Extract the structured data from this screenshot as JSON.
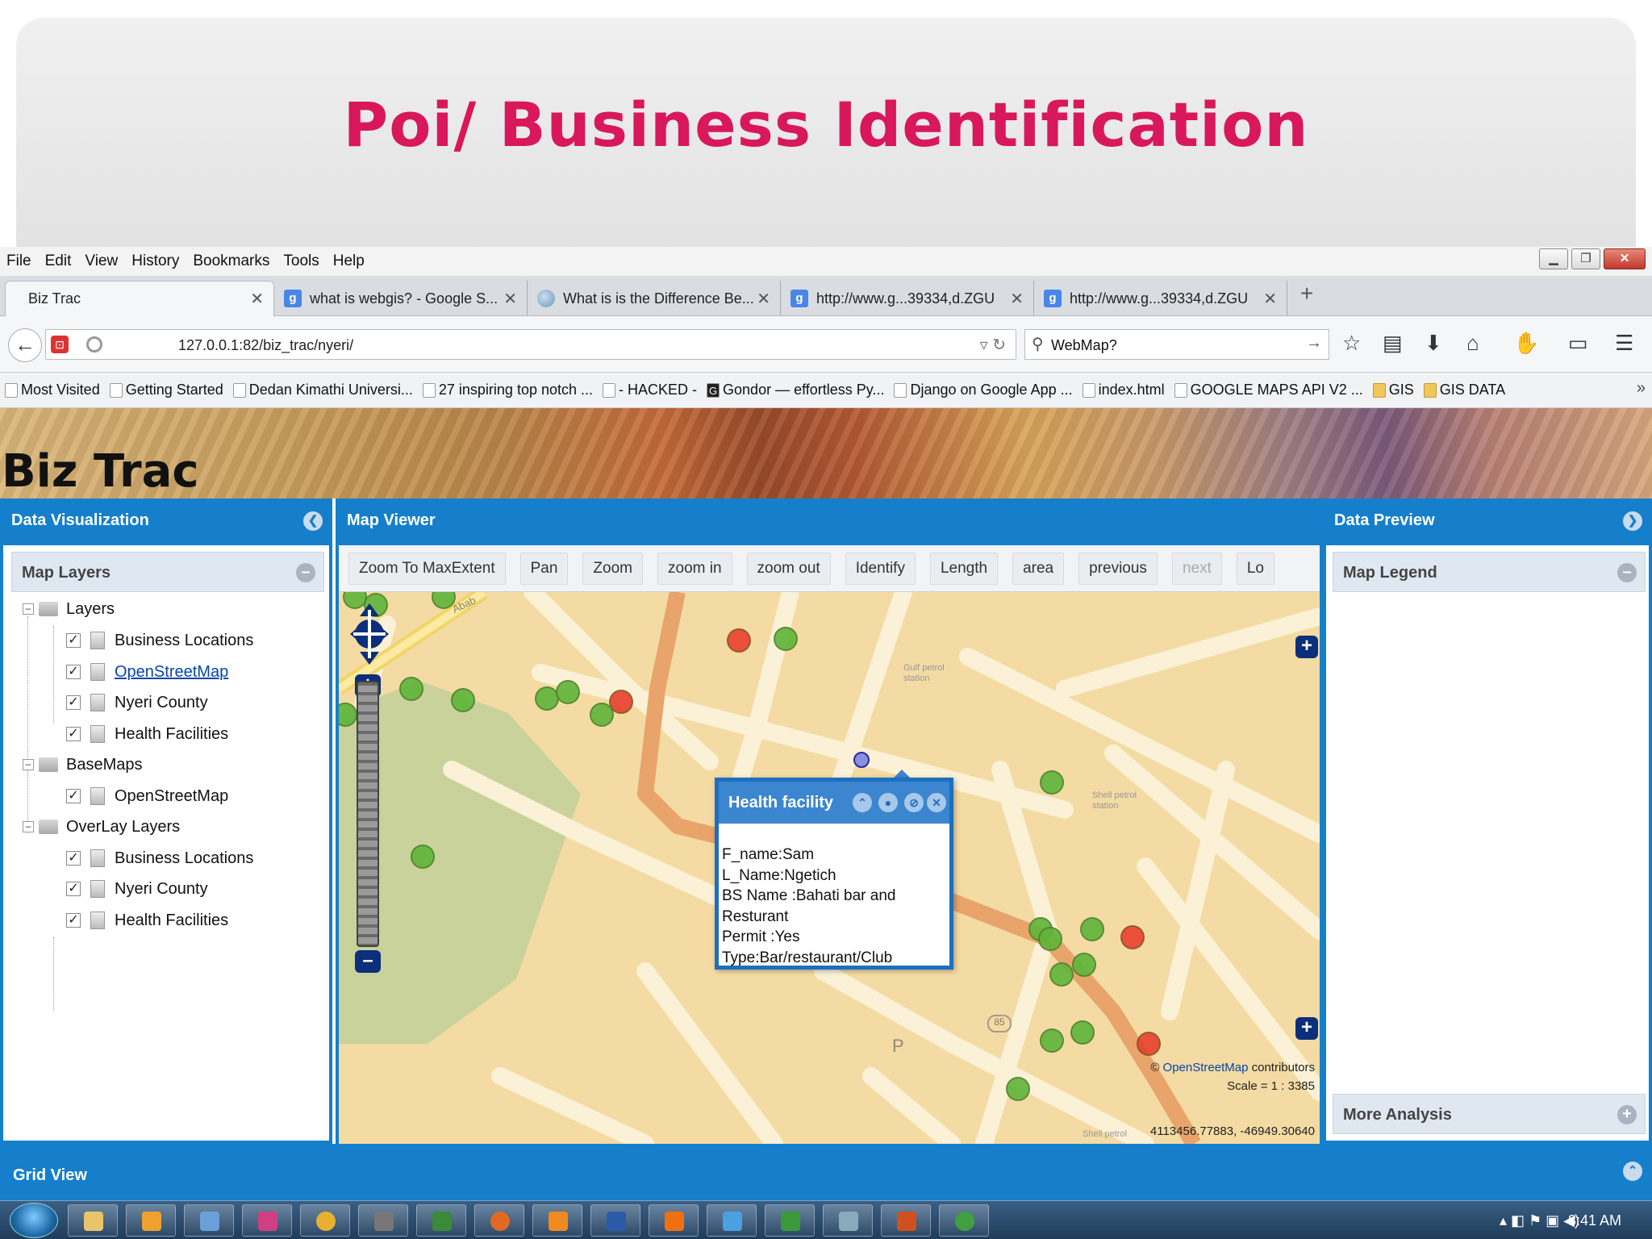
{
  "slide": {
    "title": "Poi/ Business Identification"
  },
  "browser": {
    "menu": [
      "File",
      "Edit",
      "View",
      "History",
      "Bookmarks",
      "Tools",
      "Help"
    ],
    "tabs": [
      {
        "label": "Biz Trac",
        "active": true
      },
      {
        "label": "what is webgis? - Google S..."
      },
      {
        "label": "What is is the Difference Be..."
      },
      {
        "label": "http://www.g...39334,d.ZGU"
      },
      {
        "label": "http://www.g...39334,d.ZGU"
      }
    ],
    "new_tab": "+",
    "url": "127.0.0.1:82/biz_trac/nyeri/",
    "search": "WebMap?",
    "bookmarks": [
      "Most Visited",
      "Getting Started",
      "Dedan Kimathi Universi...",
      "27 inspiring top notch ...",
      "- HACKED -",
      "Gondor — effortless Py...",
      "Django on Google App ...",
      "index.html",
      "GOOGLE MAPS API V2 ...",
      "GIS",
      "GIS DATA"
    ]
  },
  "app": {
    "title": "Biz Trac",
    "left_panel": {
      "title": "Data Visualization",
      "section": "Map Layers",
      "groups": [
        {
          "label": "Layers",
          "items": [
            "Business Locations",
            "OpenStreetMap",
            "Nyeri County",
            "Health Facilities"
          ]
        },
        {
          "label": "BaseMaps",
          "items": [
            "OpenStreetMap"
          ]
        },
        {
          "label": "OverLay Layers",
          "items": [
            "Business Locations",
            "Nyeri County",
            "Health Facilities"
          ]
        }
      ]
    },
    "center_panel": {
      "title": "Map Viewer",
      "tools": [
        "Zoom To MaxExtent",
        "Pan",
        "Zoom",
        "zoom in",
        "zoom out",
        "Identify",
        "Length",
        "area",
        "previous",
        "next",
        "Lo"
      ],
      "map_labels": [
        "Abab",
        "Gulf petrol station",
        "Shell petrol station",
        "85",
        "P",
        "Shell petrol"
      ],
      "attribution": {
        "prefix": "©",
        "link": "OpenStreetMap",
        "suffix": "contributors"
      },
      "scale": "Scale = 1 : 3385",
      "coordinates": "4113456.77883, -46949.30640",
      "popup": {
        "title": "Health facility",
        "lines": [
          "F_name:Sam",
          "L_Name:Ngetich",
          "BS Name :Bahati bar and",
          "Resturant",
          "Permit :Yes",
          "Type:Bar/restaurant/Club"
        ]
      }
    },
    "right_panel": {
      "title": "Data Preview",
      "section": "Map Legend",
      "more": "More Analysis"
    },
    "bottom_panel": {
      "title": "Grid View"
    }
  },
  "taskbar": {
    "clock": "8:41 AM"
  },
  "colors": {
    "accent": "#157fcc",
    "slide_title": "#d8185a",
    "marker_green": "#5fb53a",
    "marker_red": "#e8402e"
  }
}
